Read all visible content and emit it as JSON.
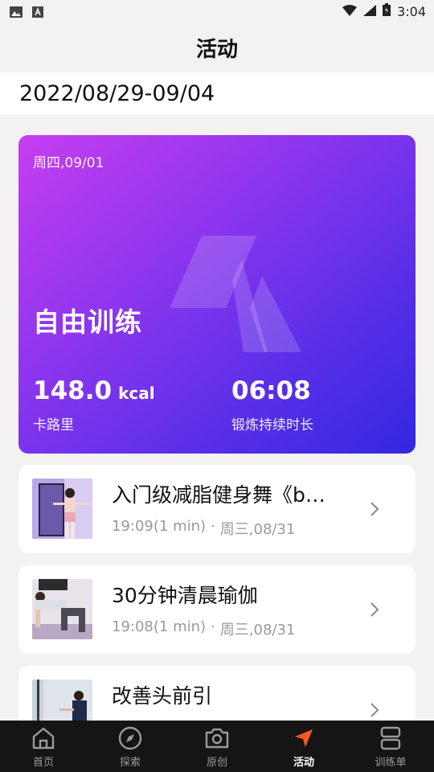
{
  "status_bar": {
    "time": "3:04",
    "left_icons": [
      "image-icon",
      "a-icon"
    ],
    "right_icons": [
      "wifi-icon",
      "signal-icon",
      "battery-icon"
    ]
  },
  "header": {
    "title": "活动"
  },
  "date_range": "2022/08/29-09/04",
  "hero": {
    "date": "周四,09/01",
    "title": "自由训练",
    "calories_value": "148.0",
    "calories_unit": "kcal",
    "calories_label": "卡路里",
    "duration_value": "06:08",
    "duration_label": "锻炼持续时长",
    "gradient_colors": [
      "#c63ef0",
      "#3327e0"
    ]
  },
  "activities": [
    {
      "title": "入门级减脂健身舞《b…",
      "time": "19:09(1 min)",
      "separator": "·",
      "date": "周三,08/31"
    },
    {
      "title": "30分钟清晨瑜伽",
      "time": "19:08(1 min)",
      "separator": "·",
      "date": "周三,08/31"
    },
    {
      "title": "改善头前引",
      "time": "",
      "separator": "",
      "date": ""
    }
  ],
  "nav": {
    "items": [
      {
        "label": "首页",
        "icon": "home-icon",
        "active": false
      },
      {
        "label": "探索",
        "icon": "compass-icon",
        "active": false
      },
      {
        "label": "原创",
        "icon": "camera-icon",
        "active": false
      },
      {
        "label": "活动",
        "icon": "navigation-arrow-icon",
        "active": true
      },
      {
        "label": "训练单",
        "icon": "training-list-icon",
        "active": false
      }
    ],
    "active_color": "#f25a22"
  }
}
